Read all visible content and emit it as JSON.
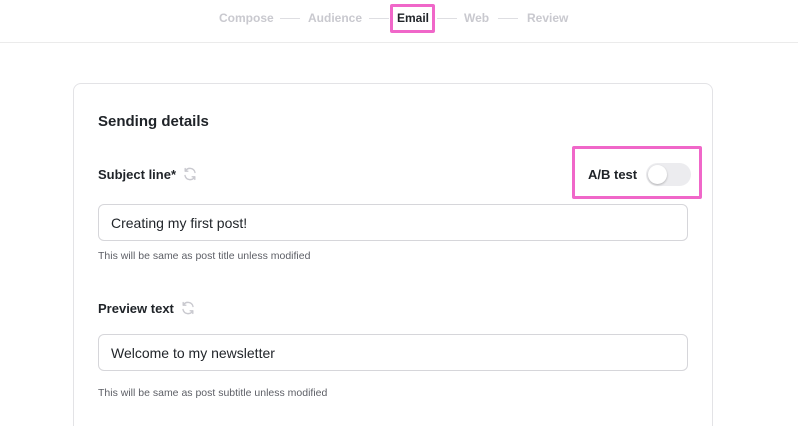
{
  "stepper": {
    "steps": [
      {
        "label": "Compose",
        "active": false
      },
      {
        "label": "Audience",
        "active": false
      },
      {
        "label": "Email",
        "active": true
      },
      {
        "label": "Web",
        "active": false
      },
      {
        "label": "Review",
        "active": false
      }
    ]
  },
  "card": {
    "title": "Sending details",
    "subject": {
      "label": "Subject line*",
      "value": "Creating my first post!",
      "helper": "This will be same as post title unless modified"
    },
    "ab_test": {
      "label": "A/B test",
      "enabled": false
    },
    "preview": {
      "label": "Preview text",
      "value": "Welcome to my newsletter",
      "helper": "This will be same as post subtitle unless modified"
    }
  },
  "colors": {
    "highlight": "#f067c9",
    "inactive_step": "#c9c9cf",
    "text": "#1f2328"
  },
  "icons": {
    "refresh": "refresh-icon"
  }
}
